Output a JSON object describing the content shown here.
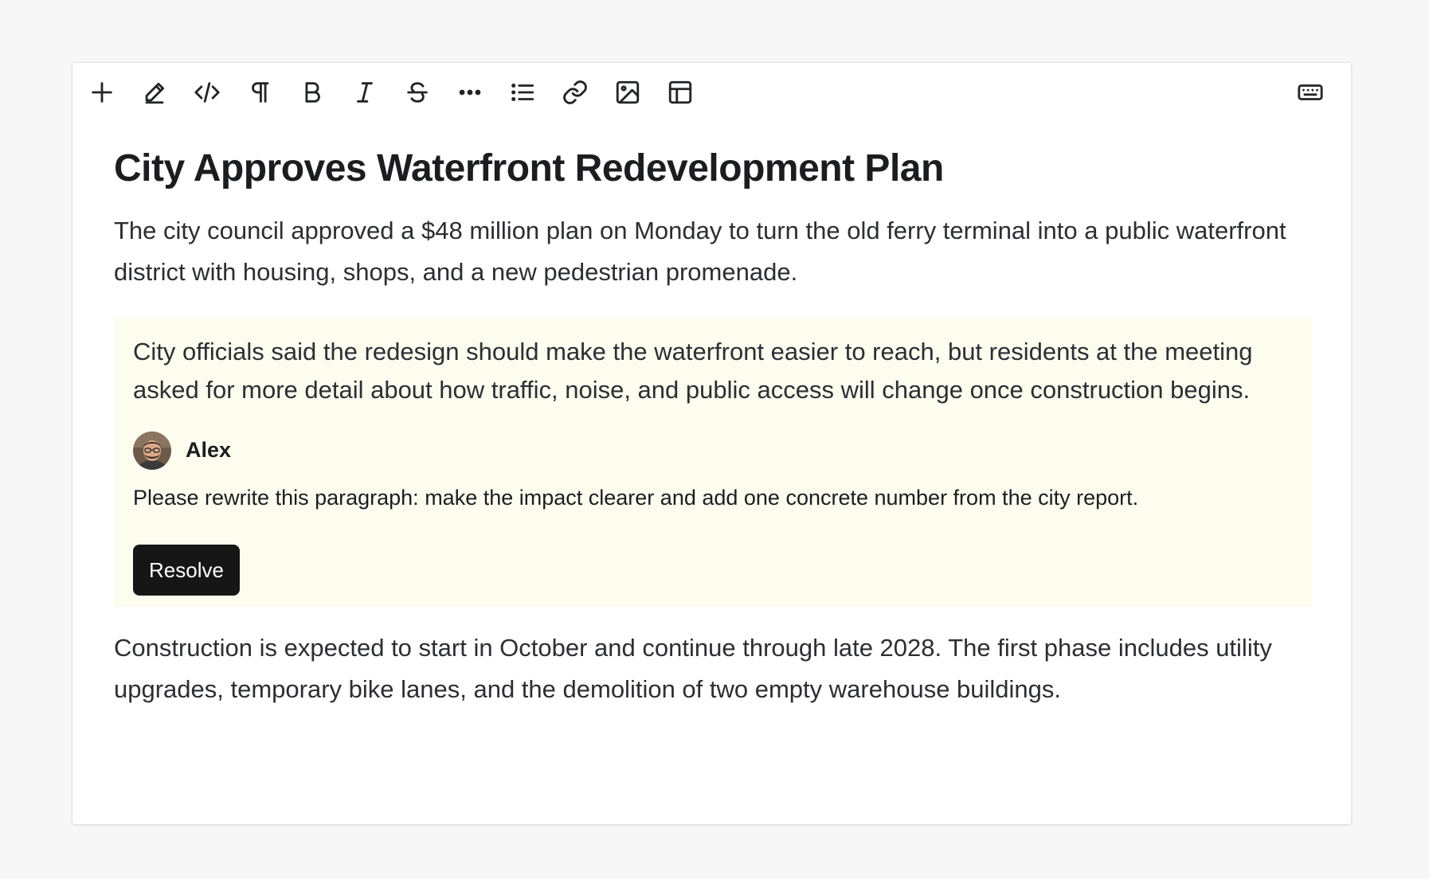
{
  "toolbar": {
    "icons": [
      "plus-icon",
      "pencil-icon",
      "code-icon",
      "paragraph-icon",
      "bold-icon",
      "italic-icon",
      "strikethrough-icon",
      "more-icon",
      "list-icon",
      "link-icon",
      "image-icon",
      "table-icon",
      "keyboard-icon"
    ]
  },
  "document": {
    "title": "City Approves Waterfront Redevelopment Plan",
    "paragraph1": "The city council approved a $48 million plan on Monday to turn the old ferry terminal into a public waterfront district with housing, shops, and a new pedestrian promenade.",
    "commented_paragraph": "City officials said the redesign should make the waterfront easier to reach, but residents at the meeting asked for more detail about how traffic, noise, and public access will change once construction begins.",
    "paragraph3": "Construction is expected to start in October and continue through late 2028. The first phase includes utility upgrades, temporary bike lanes, and the demolition of two empty warehouse buildings."
  },
  "comment": {
    "author": "Alex",
    "text": "Please rewrite this paragraph: make the impact clearer and add one concrete number from the city report.",
    "resolve_label": "Resolve"
  },
  "colors": {
    "highlight": "#fcfdef",
    "button": "#161616",
    "text": "#2c2e33"
  }
}
